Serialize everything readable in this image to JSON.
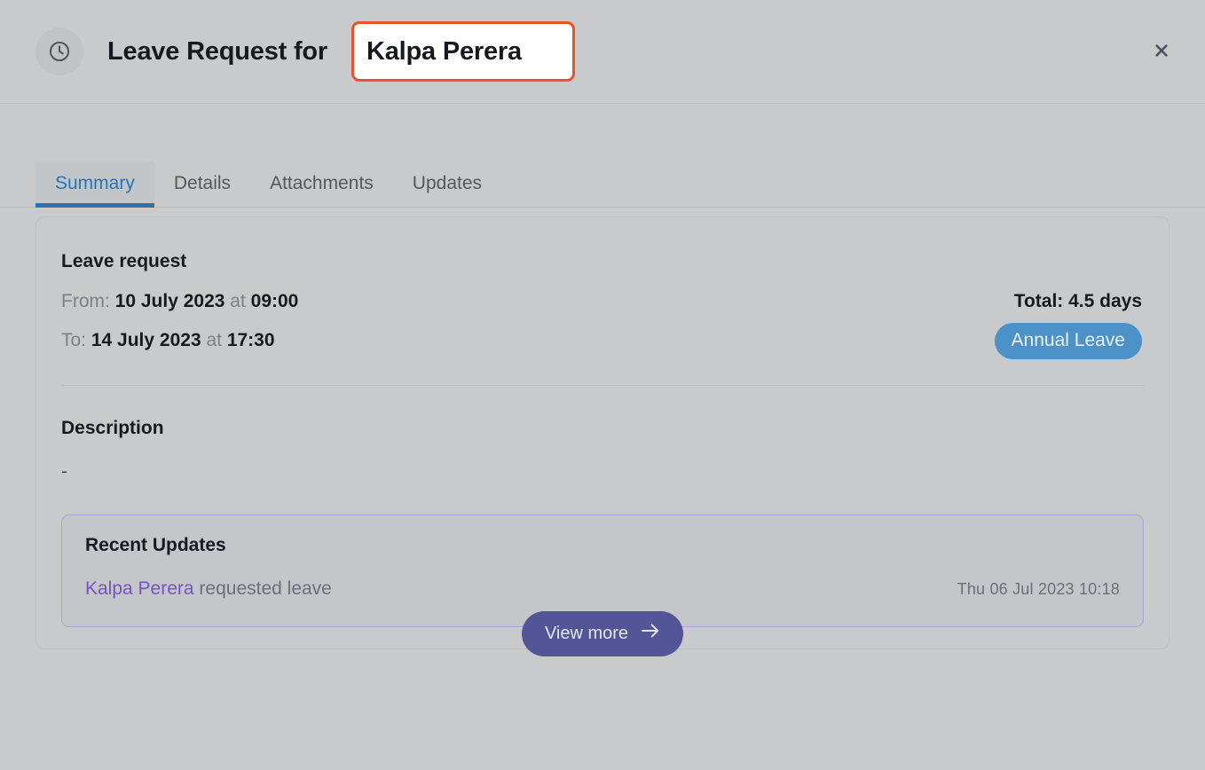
{
  "header": {
    "icon": "clock-icon",
    "title_prefix": "Leave Request for",
    "highlighted_name": "Kalpa Perera",
    "close_label": "✕",
    "highlight_border_color": "#e8522c"
  },
  "tabs": [
    {
      "label": "Summary",
      "active": true
    },
    {
      "label": "Details",
      "active": false
    },
    {
      "label": "Attachments",
      "active": false
    },
    {
      "label": "Updates",
      "active": false
    }
  ],
  "leave_request": {
    "section_title": "Leave request",
    "from_label": "From:",
    "from_date": "10 July 2023",
    "from_at": "at",
    "from_time": "09:00",
    "to_label": "To:",
    "to_date": "14 July 2023",
    "to_at": "at",
    "to_time": "17:30",
    "total": "Total: 4.5 days",
    "badge": "Annual Leave",
    "badge_color": "#4c92c9"
  },
  "description": {
    "title": "Description",
    "value": "-"
  },
  "recent_updates": {
    "title": "Recent Updates",
    "items": [
      {
        "user": "Kalpa Perera",
        "action": "requested leave",
        "timestamp": "Thu 06 Jul 2023  10:18"
      }
    ],
    "view_more_label": "View more",
    "view_more_color": "#535597",
    "border_color": "#a9a7d4"
  }
}
